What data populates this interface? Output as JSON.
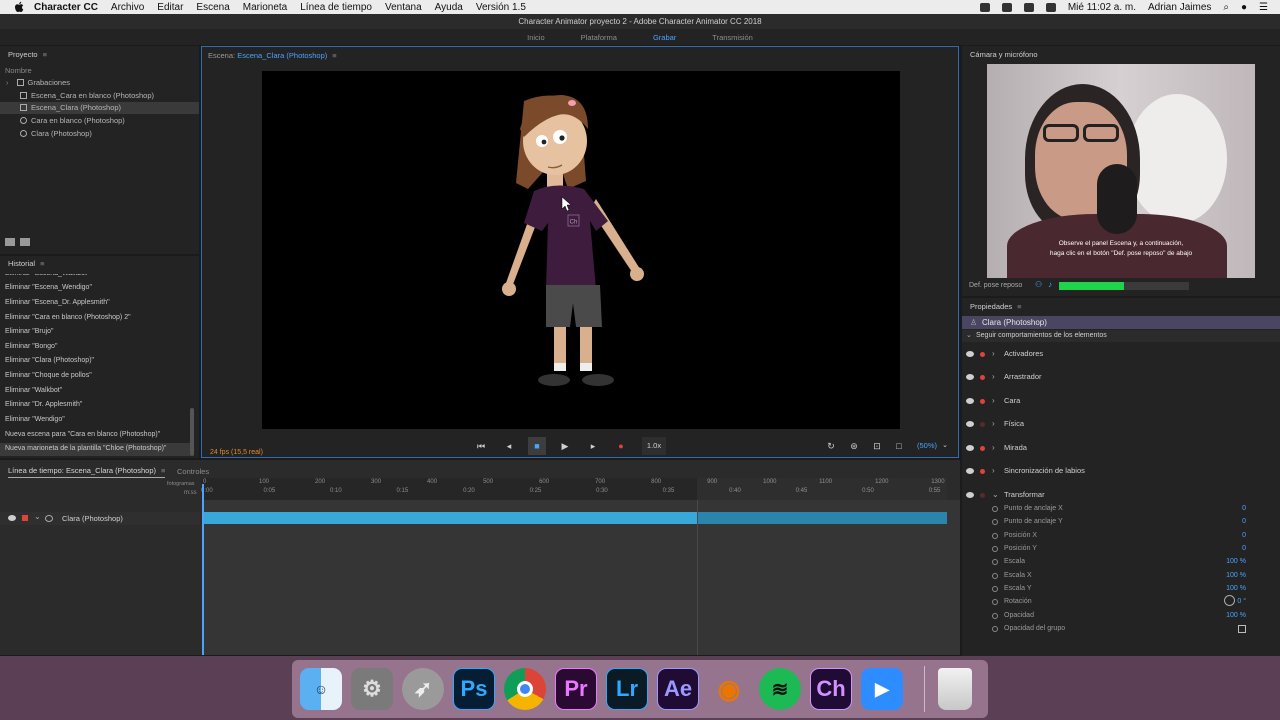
{
  "menubar": {
    "app": "Character CC",
    "items": [
      "Archivo",
      "Editar",
      "Escena",
      "Marioneta",
      "Línea de tiempo",
      "Ventana",
      "Ayuda",
      "Versión 1.5"
    ],
    "clock": "Mié 11:02 a. m.",
    "user": "Adrian Jaimes"
  },
  "window_title": "Character Animator proyecto 2 - Adobe Character Animator CC 2018",
  "workspace_tabs": [
    "Inicio",
    "Plataforma",
    "Grabar",
    "Transmisión"
  ],
  "project": {
    "title": "Proyecto",
    "column": "Nombre",
    "items": [
      "Grabaciones",
      "Escena_Cara en blanco (Photoshop)",
      "Escena_Clara (Photoshop)",
      "Cara en blanco (Photoshop)",
      "Clara (Photoshop)"
    ]
  },
  "history": {
    "title": "Historial",
    "items": [
      "Eliminar \"Escena_Walkbot\"",
      "Eliminar \"Escena_Wendigo\"",
      "Eliminar \"Escena_Dr. Applesmith\"",
      "Eliminar \"Cara en blanco (Photoshop) 2\"",
      "Eliminar \"Brujo\"",
      "Eliminar \"Bongo\"",
      "Eliminar \"Clara (Photoshop)\"",
      "Eliminar \"Choque de pollos\"",
      "Eliminar \"Walkbot\"",
      "Eliminar \"Dr. Applesmith\"",
      "Eliminar \"Wendigo\"",
      "Nueva escena para \"Cara en blanco (Photoshop)\"",
      "Nueva marioneta de la plantilla \"Chloe (Photoshop)\""
    ]
  },
  "scene": {
    "label": "Escena:",
    "name": "Escena_Clara (Photoshop)",
    "badge": "Ch",
    "fps": "24 fps (15,5 real)",
    "speed": "1.0x",
    "zoom": "(50%)"
  },
  "timeline": {
    "title": "Línea de tiempo: Escena_Clara (Photoshop)",
    "tab2": "Controles",
    "frames_label": "fotogramas",
    "time_label": "m:ss",
    "frame_ticks": [
      "0",
      "100",
      "200",
      "300",
      "400",
      "500",
      "600",
      "700",
      "800",
      "900",
      "1000",
      "1100",
      "1200",
      "1300"
    ],
    "time_ticks": [
      "0:00",
      "0:05",
      "0:10",
      "0:15",
      "0:20",
      "0:25",
      "0:30",
      "0:35",
      "0:40",
      "0:45",
      "0:50",
      "0:55"
    ],
    "track": "Clara (Photoshop)"
  },
  "camera": {
    "title": "Cámara y micrófono",
    "caption_line1": "Observe el panel Escena y, a continuación,",
    "caption_line2": "haga clic en el botón \"Def. pose reposo\" de abajo",
    "rest_pose": "Def. pose reposo",
    "level": 0.5
  },
  "props": {
    "title": "Propiedades",
    "puppet": "Clara (Photoshop)",
    "section": "Seguir comportamientos de los elementos",
    "behaviors": [
      "Activadores",
      "Arrastrador",
      "Cara",
      "Física",
      "Mirada",
      "Sincronización de labios",
      "Transformar"
    ],
    "params": [
      {
        "label": "Punto de anclaje X",
        "value": "0"
      },
      {
        "label": "Punto de anclaje Y",
        "value": "0"
      },
      {
        "label": "Posición X",
        "value": "0"
      },
      {
        "label": "Posición Y",
        "value": "0"
      },
      {
        "label": "Escala",
        "value": "100 %"
      },
      {
        "label": "Escala X",
        "value": "100 %"
      },
      {
        "label": "Escala Y",
        "value": "100 %"
      },
      {
        "label": "Rotación",
        "value": "0 °"
      },
      {
        "label": "Opacidad",
        "value": "100 %"
      },
      {
        "label": "Opacidad del grupo",
        "value": ""
      }
    ]
  },
  "dock": [
    "Finder",
    "System Preferences",
    "Launchpad",
    "Ps",
    "Chrome",
    "Pr",
    "Lr",
    "Ae",
    "Blender",
    "Spotify",
    "Ch",
    "Zoom",
    "Trash"
  ]
}
